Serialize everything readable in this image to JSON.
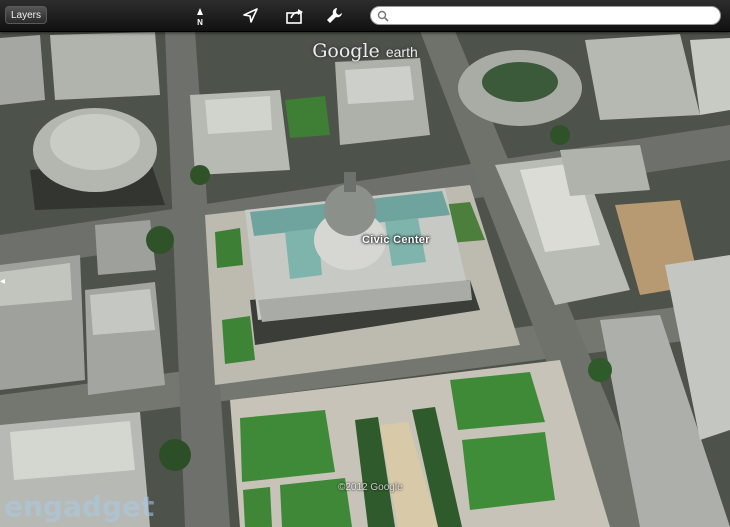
{
  "toolbar": {
    "layers_label": "Layers",
    "north_label": "N",
    "icons": {
      "north": "compass-north-icon",
      "locate": "location-arrow-icon",
      "share": "share-icon",
      "tools": "wrench-icon",
      "search": "search-icon"
    }
  },
  "search": {
    "value": "",
    "placeholder": ""
  },
  "map": {
    "brand_google": "Google",
    "brand_earth": "earth",
    "place_label": "Civic Center",
    "copyright": "©2012 Google",
    "watermark": "engadget"
  },
  "colors": {
    "toolbar": "#1e1e1e",
    "lawn": "#3f8a3a",
    "roof": "#b9bcb6",
    "plaza": "#cfcac0",
    "road": "#6f726c"
  }
}
